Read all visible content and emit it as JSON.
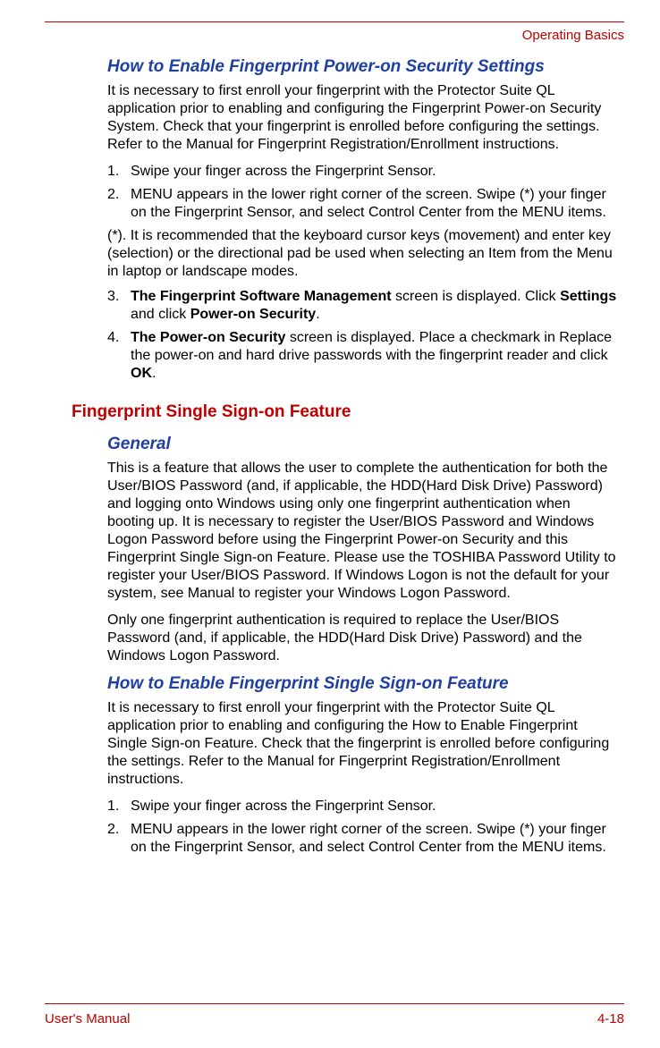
{
  "header": {
    "section_title": "Operating Basics"
  },
  "section1": {
    "heading": "How to Enable Fingerprint Power-on Security Settings",
    "intro": "It is necessary to first enroll your fingerprint with the Protector Suite QL application prior to enabling and configuring the Fingerprint Power-on Security System. Check that your fingerprint is enrolled before configuring the settings. Refer to the Manual for Fingerprint Registration/Enrollment instructions.",
    "steps": {
      "s1": {
        "num": "1.",
        "text": "Swipe your finger across the Fingerprint Sensor."
      },
      "s2": {
        "num": "2.",
        "text": "MENU appears in the lower right corner of the screen. Swipe (*) your finger on the Fingerprint Sensor, and select Control Center from the MENU items."
      }
    },
    "note": "(*). It is recommended that the keyboard cursor keys (movement) and enter key (selection) or the directional pad be used when selecting an Item from the Menu in laptop or landscape modes.",
    "steps2": {
      "s3": {
        "num": "3.",
        "bold1": "The Fingerprint Software Management",
        "mid1": " screen is displayed. Click ",
        "bold2": "Settings",
        "mid2": " and click ",
        "bold3": "Power-on Security",
        "tail": "."
      },
      "s4": {
        "num": "4.",
        "bold1": "The Power-on Security",
        "mid1": " screen is displayed. Place a checkmark in Replace the power-on and hard drive passwords with the fingerprint reader and click ",
        "bold2": "OK",
        "tail": "."
      }
    }
  },
  "section2": {
    "heading": "Fingerprint Single Sign-on Feature",
    "sub1": {
      "heading": "General",
      "p1": "This is a feature that allows the user to complete the authentication for both the User/BIOS Password (and, if applicable, the HDD(Hard Disk Drive) Password) and logging onto Windows using only one fingerprint authentication when booting up. It is necessary to register the User/BIOS Password and Windows Logon Password before using the Fingerprint Power-on Security and this Fingerprint Single Sign-on Feature. Please use the TOSHIBA Password Utility to register your User/BIOS Password. If Windows Logon is not the default for your system, see Manual to register your Windows Logon Password.",
      "p2": "Only one fingerprint authentication is required to replace the User/BIOS Password (and, if applicable, the HDD(Hard Disk Drive) Password) and the Windows Logon Password."
    },
    "sub2": {
      "heading": "How to Enable Fingerprint Single Sign-on Feature",
      "intro": "It is necessary to first enroll your fingerprint with the Protector Suite QL application prior to enabling and configuring the How to Enable Fingerprint Single Sign-on Feature. Check that the fingerprint is enrolled before configuring the settings. Refer to the Manual for Fingerprint Registration/Enrollment instructions.",
      "steps": {
        "s1": {
          "num": "1.",
          "text": "Swipe your finger across the Fingerprint Sensor."
        },
        "s2": {
          "num": "2.",
          "text": "MENU appears in the lower right corner of the screen. Swipe (*) your finger on the Fingerprint Sensor, and select Control Center from the MENU items."
        }
      }
    }
  },
  "footer": {
    "left": "User's Manual",
    "right": "4-18"
  }
}
